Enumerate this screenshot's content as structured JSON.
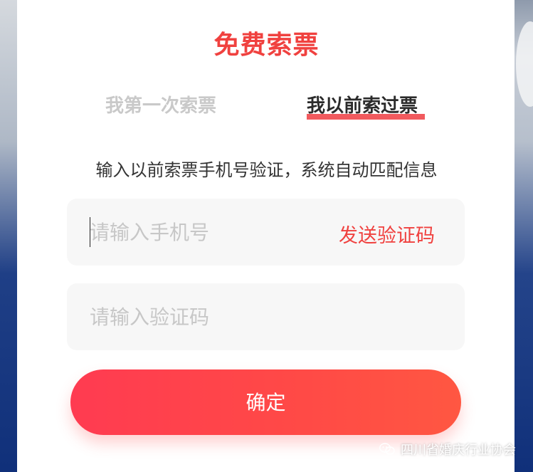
{
  "header": {
    "title": "免费索票"
  },
  "tabs": [
    {
      "label": "我第一次索票",
      "active": false
    },
    {
      "label": "我以前索过票",
      "active": true
    }
  ],
  "description": "输入以前索票手机号验证，系统自动匹配信息",
  "phone_field": {
    "value": "",
    "placeholder": "请输入手机号",
    "send_code_label": "发送验证码"
  },
  "code_field": {
    "value": "",
    "placeholder": "请输入验证码"
  },
  "confirm_label": "确定",
  "watermark": {
    "icon": "wechat-icon",
    "text": "四川省婚庆行业协会"
  },
  "colors": {
    "accent": "#f0413f",
    "tab_underline": "#f15a5e",
    "field_bg": "#f7f7f7",
    "inactive_tab": "#c9c9c9"
  }
}
